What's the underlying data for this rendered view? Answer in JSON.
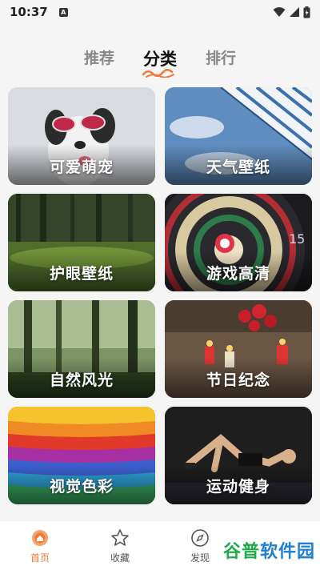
{
  "status_bar": {
    "time": "10:37",
    "notification_badge": "A"
  },
  "tabs": [
    {
      "label": "推荐",
      "active": false
    },
    {
      "label": "分类",
      "active": true
    },
    {
      "label": "排行",
      "active": false
    }
  ],
  "categories": [
    {
      "label": "可爱萌宠",
      "art": "dog-with-sunglasses"
    },
    {
      "label": "天气壁纸",
      "art": "umbrella-blue-sky"
    },
    {
      "label": "护眼壁纸",
      "art": "forest-grass"
    },
    {
      "label": "游戏高清",
      "art": "dartboard"
    },
    {
      "label": "自然风光",
      "art": "misty-forest"
    },
    {
      "label": "节日纪念",
      "art": "candles-roses"
    },
    {
      "label": "视觉色彩",
      "art": "rainbow-paint"
    },
    {
      "label": "运动健身",
      "art": "person-workout"
    }
  ],
  "bottom_nav": [
    {
      "label": "首页",
      "icon": "home-icon",
      "active": true
    },
    {
      "label": "收藏",
      "icon": "star-icon",
      "active": false
    },
    {
      "label": "发现",
      "icon": "compass-icon",
      "active": false
    }
  ],
  "watermark": {
    "part1": "谷普",
    "part2": "软件园"
  },
  "colors": {
    "accent": "#f07a3a",
    "text_inactive": "#888888",
    "background": "#f5f5f5"
  }
}
